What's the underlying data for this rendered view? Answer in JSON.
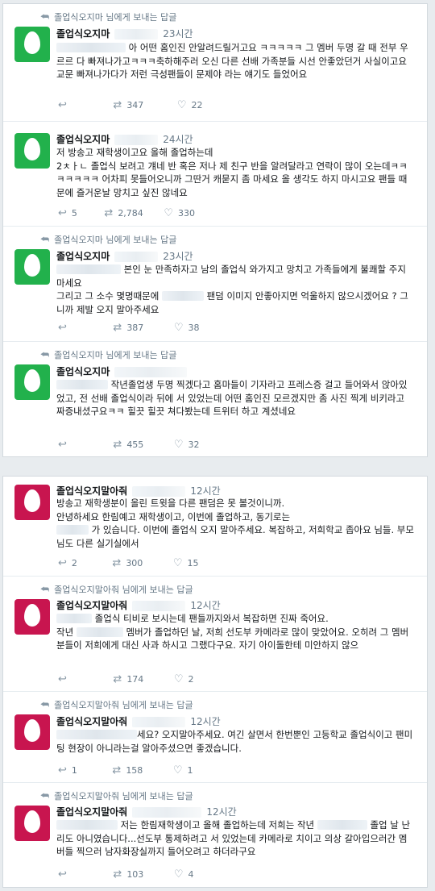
{
  "colors": {
    "avatar_green": "#22b14c",
    "avatar_magenta": "#c8154f"
  },
  "block1": {
    "tweets": [
      {
        "context": "졸업식오지마 님에게 보내는 답글",
        "name": "졸업식오지마",
        "time": "23시간",
        "text_a": "아 어떤 홈인진 안알려드릴거고요 ㅋㅋㅋㅋㅋ 그 멤버 두명 갈 때 전부 우르르 다 빠져나가고ㅋㅋㅋ축하해주러 오신 다른 선배 가족분들 시선 안좋았던거 사실이고요 교문 빠져나가다가 저런 극성팬들이 문제야 라는 얘기도 들었어요",
        "reply": "",
        "retweet": "347",
        "like": "22"
      },
      {
        "context": "",
        "name": "졸업식오지마",
        "time": "24시간",
        "text_a": "저 방송고 재학생이고요 올해 졸업하는데",
        "text_b": "2ㅊㅏㄴ 졸업식 보려고 걔네 반 혹은 저나 제 친구 반을 알려달라고 연락이 많이 오는데ㅋㅋㅋㅋㅋㅋㅋ 어차피 못들어오니까 그딴거 캐묻지 좀 마세요 올 생각도 하지 마시고요 팬들 때문에 즐거운날 망치고 싶진 않네요",
        "reply": "5",
        "retweet": "2,784",
        "like": "330"
      },
      {
        "context": "졸업식오지마 님에게 보내는 답글",
        "name": "졸업식오지마",
        "time": "23시간",
        "text_a": "본인 눈 만족하자고 남의 졸업식  와가지고 망치고 가족들에게 불쾌할 주지 마세요",
        "text_b": "그리고 그 소수 몇명때문에",
        "text_c": "팬덤 이미지 안좋아지면 억울하지 않으시겠어요 ? 그니까 제발 오지 말아주세요",
        "reply": "",
        "retweet": "387",
        "like": "38"
      },
      {
        "context": "졸업식오지마 님에게 보내는 답글",
        "name": "졸업식오지마",
        "time": "",
        "text_a": "작년졸업생 두명 찍겠다고 홈마들이 기자라고 프레스증 걸고 들어와서 앉아있었고, 전 선배 졸업식이라 뒤에 서 있었는데 어떤 홈인진 모르겠지만 좀 사진 찍게 비키라고 짜증내셨구요ㅋㅋ 힐끗 힐끗 쳐다봤는데 트위터 하고 계셨네요",
        "reply": "",
        "retweet": "455",
        "like": "32"
      }
    ]
  },
  "block2": {
    "tweets": [
      {
        "context": "",
        "name": "졸업식오지말아줘",
        "time": "12시간",
        "text_a": "방송고 재학생분이 올린 트윗을 다른 팬덤은 못 볼것이니까.",
        "text_b": "안녕하세요 한림예고 재학생이고, 이번에 졸업하고, 동기로는",
        "text_c": "가 있습니다. 이번에 졸업식 오지 말아주세요. 복잡하고, 저희학교 좁아요 님들. 부모님도 다른 실기실에서",
        "reply": "2",
        "retweet": "300",
        "like": "15"
      },
      {
        "context": "졸업식오지말아줘 님에게 보내는 답글",
        "name": "졸업식오지말아줘",
        "time": "12시간",
        "text_a": "졸업식 티비로 보시는데 팬들까지와서 복잡하면 진짜 죽어요.",
        "text_b": "작년",
        "text_c": "멤버가 졸업하던 날, 저희 선도부 카메라로 많이 맞았어요. 오히려 그 멤버분들이 저희에게 대신 사과 하시고 그랬다구요. 자기 아이돌한테 미안하지 않으",
        "reply": "",
        "retweet": "174",
        "like": "2"
      },
      {
        "context": "졸업식오지말아줘 님에게 보내는 답글",
        "name": "졸업식오지말아줘",
        "time": "12시간",
        "text_a": "세요? 오지말아주세요. 여긴 살면서 한번뿐인 고등학교 졸업식이고 팬미팅 현장이 아니라는걸 알아주셨으면 좋겠습니다.",
        "reply": "1",
        "retweet": "158",
        "like": "1"
      },
      {
        "context": "졸업식오지말아줘 님에게 보내는 답글",
        "name": "졸업식오지말아줘",
        "time": "12시간",
        "text_a": "저는 한림재학생이고 올해 졸업하는데 저희는 작년",
        "text_b": "졸업 날 난리도 아니였습니다...선도부 통제하려고 서 있었는데 카메라로 치이고 의상 갈아입으러간 멤버들 찍으러 남자화장실까지 들어오려고 하더라구요",
        "reply": "",
        "retweet": "103",
        "like": "4"
      }
    ]
  }
}
